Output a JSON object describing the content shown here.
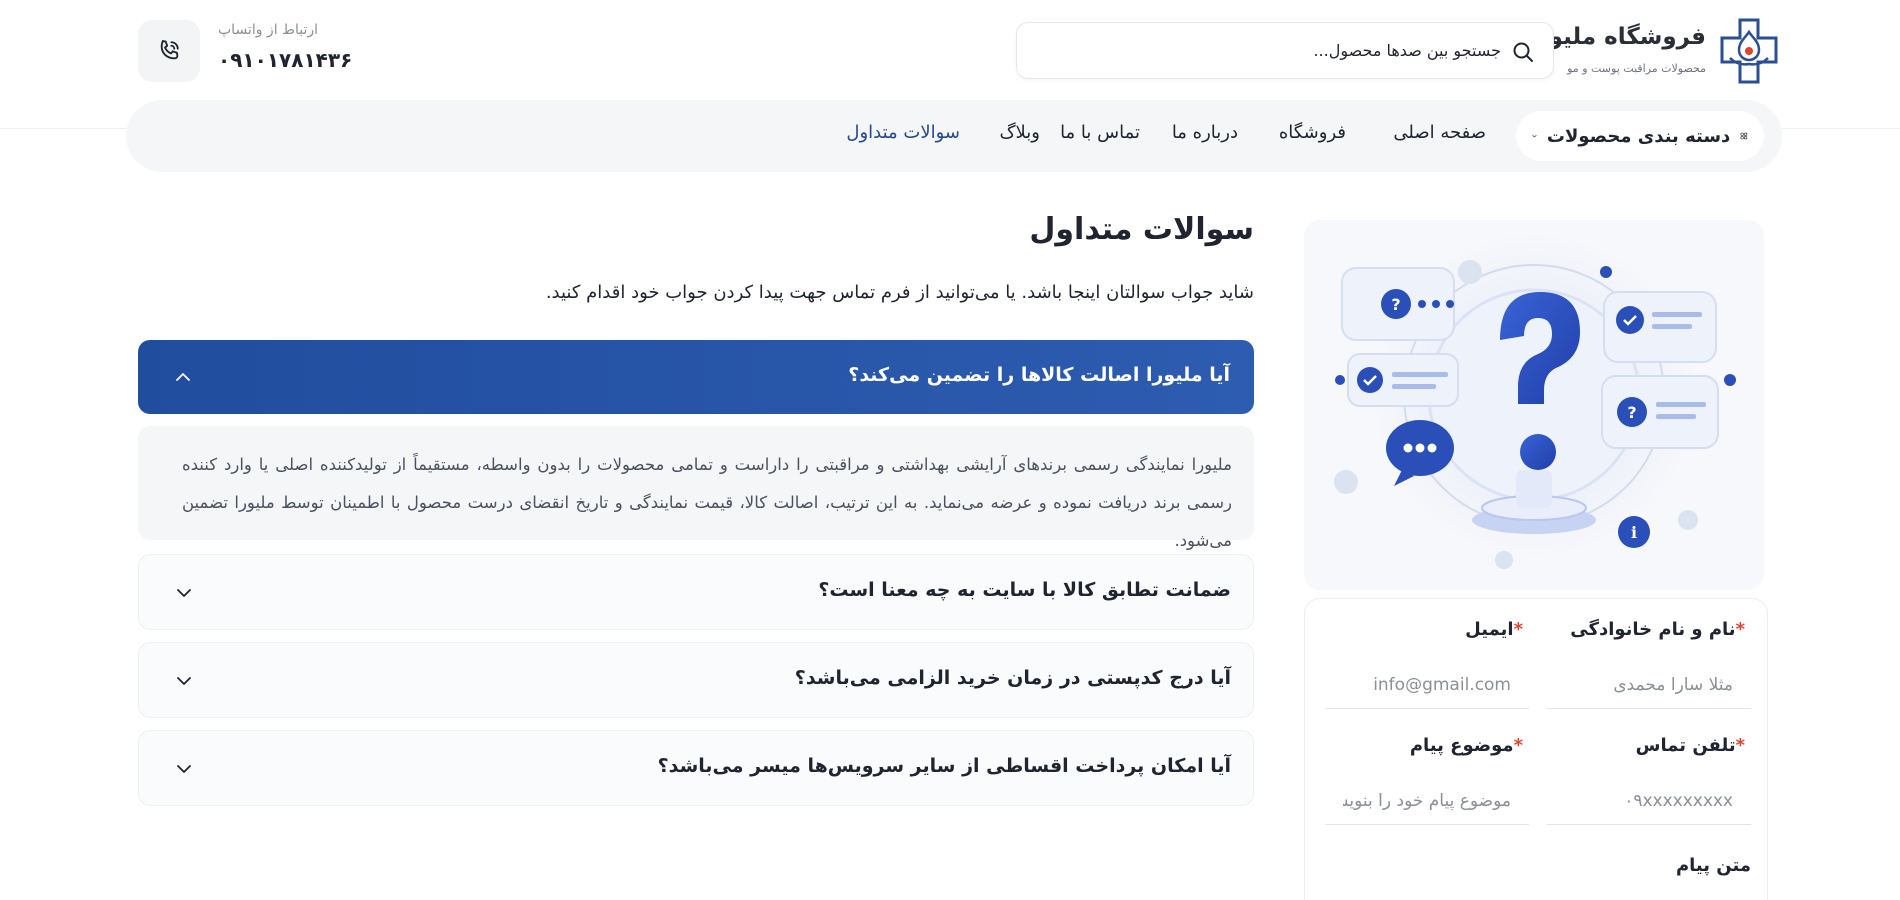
{
  "brand": {
    "name": "فروشگاه ملیورا",
    "tagline": "محصولات مراقبت پوست و مو"
  },
  "search": {
    "placeholder": "جستجو بین صدها محصول..."
  },
  "contact": {
    "label": "ارتباط از واتساپ",
    "phone": "۰۹۱۰۱۷۸۱۴۳۶"
  },
  "nav": {
    "categories_label": "دسته بندی محصولات",
    "items": [
      {
        "label": "صفحه اصلی"
      },
      {
        "label": "فروشگاه"
      },
      {
        "label": "درباره ما"
      },
      {
        "label": "تماس با ما"
      },
      {
        "label": "وبلاگ"
      },
      {
        "label": "سوالات متداول"
      }
    ]
  },
  "main": {
    "title": "سوالات متداول",
    "subtitle": "شاید جواب سوالتان اینجا باشد. یا می‌توانید از فرم تماس جهت پیدا کردن جواب خود اقدام کنید.",
    "faqs": [
      {
        "question": "آیا ملیورا اصالت کالاها را تضمین می‌کند؟",
        "answer": "ملیورا نمایندگی رسمی برندهای آرایشی بهداشتی و مراقبتی را داراست و تمامی محصولات را بدون واسطه، مستقیماً از تولیدکننده اصلی یا وارد کننده رسمی برند دریافت نموده و عرضه می‌نماید. به این ترتیب، اصالت کالا، قیمت نمایندگی و تاریخ انقضای درست محصول با اطمینان توسط ملیورا تضمین می‌شود."
      },
      {
        "question": "ضمانت تطابق کالا با سایت به چه معنا است؟"
      },
      {
        "question": "آیا درج کدپستی در زمان خرید الزامی می‌باشد؟"
      },
      {
        "question": "آیا امکان پرداخت اقساطی از سایر سرویس‌ها میسر می‌باشد؟"
      }
    ]
  },
  "form": {
    "name_label": "نام و نام خانوادگی",
    "name_placeholder": "مثلا سارا محمدی",
    "email_label": "ایمیل",
    "email_placeholder": "info@gmail.com",
    "phone_label": "تلفن تماس",
    "phone_placeholder": "۰۹xxxxxxxxx",
    "subject_label": "موضوع پیام",
    "subject_placeholder": "موضوع پیام خود را بنویسید",
    "message_label": "متن پیام",
    "required_mark": "*"
  },
  "colors": {
    "primary": "#234a8f",
    "accent_red": "#e0442e",
    "nav_bg": "#f5f6f7"
  }
}
